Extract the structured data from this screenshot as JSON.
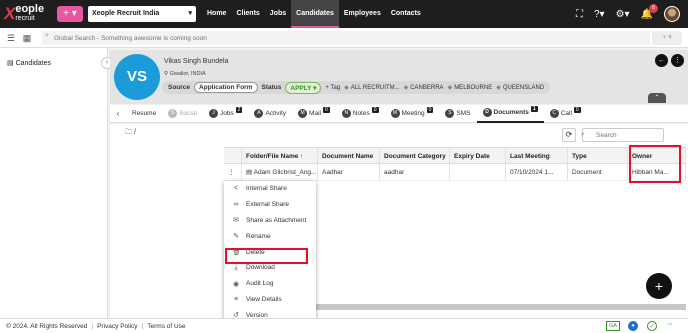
{
  "app": {
    "logo_x": "X",
    "logo_name": "eople",
    "logo_sub": "recruit",
    "org": "Xeople Recruit India",
    "plus": "+ ▾",
    "nav": [
      "Home",
      "Clients",
      "Jobs",
      "Candidates",
      "Employees",
      "Contacts"
    ],
    "active_nav": "Candidates",
    "notification_count": "8"
  },
  "search": {
    "placeholder": "Global Search - Something awesome is coming soon",
    "add": "+ ▾"
  },
  "sidebar": {
    "item": "Candidates"
  },
  "profile": {
    "initials": "VS",
    "name": "Vikas Singh Bundela",
    "location": "Gwalior, INDIA",
    "source_label": "Source",
    "source_value": "Application Form",
    "status_label": "Status",
    "status_value": "APPLY",
    "add_tag": "+ Tag",
    "tags": [
      "ALL RECRUITM...",
      "CANBERRA",
      "MELBOURNE",
      "QUEENSLAND"
    ]
  },
  "tabs": [
    {
      "label": "Resume",
      "count": "",
      "disabled": false,
      "icon": ""
    },
    {
      "label": "Social",
      "count": "",
      "disabled": true,
      "icon": "S"
    },
    {
      "label": "Jobs",
      "count": "2",
      "disabled": false,
      "icon": "J"
    },
    {
      "label": "Activity",
      "count": "",
      "disabled": false,
      "icon": "A"
    },
    {
      "label": "Mail",
      "count": "0",
      "disabled": false,
      "icon": "M"
    },
    {
      "label": "Notes",
      "count": "0",
      "disabled": false,
      "icon": "N"
    },
    {
      "label": "Meeting",
      "count": "0",
      "disabled": false,
      "icon": "M"
    },
    {
      "label": "SMS",
      "count": "",
      "disabled": false,
      "icon": "S"
    },
    {
      "label": "Documents",
      "count": "1",
      "disabled": false,
      "icon": "D",
      "active": true
    },
    {
      "label": "Call",
      "count": "0",
      "disabled": false,
      "icon": "C"
    }
  ],
  "documents": {
    "path": "/",
    "search_placeholder": "Search",
    "columns": [
      "",
      "Folder/File Name ↑",
      "Document Name",
      "Document Category",
      "Expiry Date",
      "Last Meeting",
      "Type",
      "Owner"
    ],
    "rows": [
      [
        "⋮",
        "Adam Gilchrist_Ang...",
        "Aadhar",
        "aadhar",
        "",
        "07/10/2024 1...",
        "Document",
        "Hibban Ma..."
      ]
    ]
  },
  "context_menu": [
    {
      "label": "Internal Share",
      "icon": "share-icon",
      "glyph": "<"
    },
    {
      "label": "External Share",
      "icon": "link-icon",
      "glyph": "∞"
    },
    {
      "label": "Share as Attachment",
      "icon": "mail-attach-icon",
      "glyph": "✉"
    },
    {
      "label": "Rename",
      "icon": "pencil-icon",
      "glyph": "✎"
    },
    {
      "label": "Delete",
      "icon": "trash-icon",
      "glyph": "🗑"
    },
    {
      "label": "Download",
      "icon": "download-icon",
      "glyph": "⤓"
    },
    {
      "label": "Audit Log",
      "icon": "eye-icon",
      "glyph": "◉"
    },
    {
      "label": "View Details",
      "icon": "list-icon",
      "glyph": "≡"
    },
    {
      "label": "Version",
      "icon": "history-icon",
      "glyph": "↺"
    }
  ],
  "footer": {
    "copyright": "© 2024. All Rights Reserved",
    "privacy": "Privacy Policy",
    "terms": "Terms of Use",
    "ga": "GA"
  },
  "colors": {
    "accent": "#e9579e",
    "avatar": "#1b9bd7",
    "highlight": "#e2102a",
    "status_green": "#3a8f2a"
  }
}
